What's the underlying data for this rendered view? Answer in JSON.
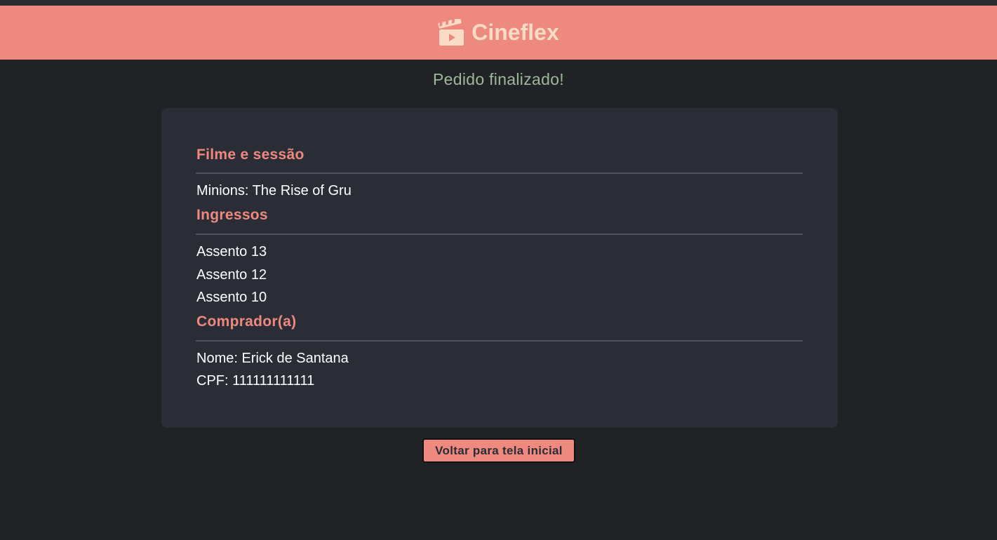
{
  "header": {
    "app_name": "Cineflex",
    "logo_icon": "clapperboard-icon"
  },
  "status": {
    "title": "Pedido finalizado!"
  },
  "order": {
    "movie_section": {
      "title": "Filme e sessão",
      "movie": "Minions: The Rise of Gru"
    },
    "tickets_section": {
      "title": "Ingressos",
      "seats": [
        "Assento 13",
        "Assento 12",
        "Assento 10"
      ]
    },
    "buyer_section": {
      "title": "Comprador(a)",
      "name_line": "Nome: Erick de Santana",
      "cpf_line": "CPF: 111111111111"
    }
  },
  "actions": {
    "back_label": "Voltar para tela inicial"
  },
  "colors": {
    "accent": "#ee897f",
    "background": "#212226",
    "card": "#2b2d36",
    "success_text": "#9db899",
    "logo_text": "#fadbc5"
  }
}
